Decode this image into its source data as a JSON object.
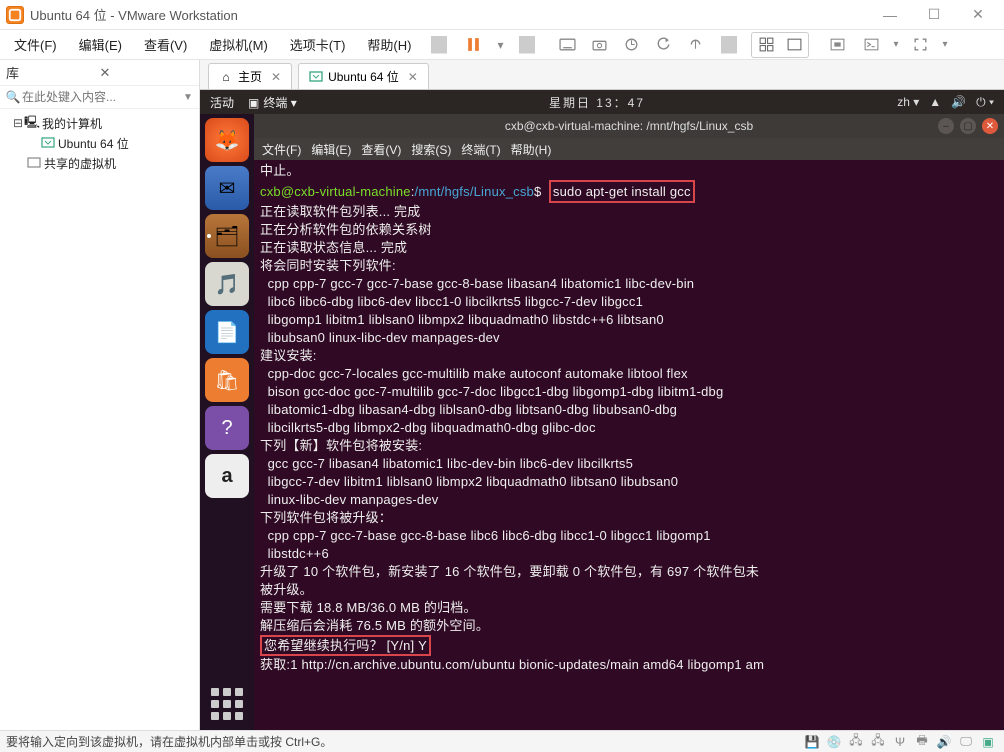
{
  "window": {
    "title": "Ubuntu 64 位 - VMware Workstation"
  },
  "menu": {
    "file": "文件(F)",
    "edit": "编辑(E)",
    "view": "查看(V)",
    "vm": "虚拟机(M)",
    "tabs": "选项卡(T)",
    "help": "帮助(H)"
  },
  "sidebar": {
    "title": "库",
    "search_placeholder": "在此处键入内容...",
    "tree": {
      "root": "我的计算机",
      "child1": "Ubuntu 64 位",
      "child2": "共享的虚拟机"
    }
  },
  "tabs": {
    "home": "主页",
    "vm": "Ubuntu 64 位"
  },
  "gnome": {
    "activities": "活动",
    "terminal_label": "终端 ▾",
    "clock": "星期日 13：47",
    "lang": "zh ▾"
  },
  "terminal": {
    "title": "cxb@cxb-virtual-machine: /mnt/hgfs/Linux_csb",
    "menu": {
      "file": "文件(F)",
      "edit": "编辑(E)",
      "view": "查看(V)",
      "search": "搜索(S)",
      "term": "终端(T)",
      "help": "帮助(H)"
    },
    "prompt_user": "cxb@cxb-virtual-machine",
    "prompt_path": "/mnt/hgfs/Linux_csb",
    "cmd": "sudo apt-get install gcc",
    "lines": [
      "中止。",
      "正在读取软件包列表... 完成",
      "正在分析软件包的依赖关系树",
      "正在读取状态信息... 完成",
      "将会同时安装下列软件:",
      "  cpp cpp-7 gcc-7 gcc-7-base gcc-8-base libasan4 libatomic1 libc-dev-bin",
      "  libc6 libc6-dbg libc6-dev libcc1-0 libcilkrts5 libgcc-7-dev libgcc1",
      "  libgomp1 libitm1 liblsan0 libmpx2 libquadmath0 libstdc++6 libtsan0",
      "  libubsan0 linux-libc-dev manpages-dev",
      "建议安装:",
      "  cpp-doc gcc-7-locales gcc-multilib make autoconf automake libtool flex",
      "  bison gcc-doc gcc-7-multilib gcc-7-doc libgcc1-dbg libgomp1-dbg libitm1-dbg",
      "  libatomic1-dbg libasan4-dbg liblsan0-dbg libtsan0-dbg libubsan0-dbg",
      "  libcilkrts5-dbg libmpx2-dbg libquadmath0-dbg glibc-doc",
      "下列【新】软件包将被安装:",
      "  gcc gcc-7 libasan4 libatomic1 libc-dev-bin libc6-dev libcilkrts5",
      "  libgcc-7-dev libitm1 liblsan0 libmpx2 libquadmath0 libtsan0 libubsan0",
      "  linux-libc-dev manpages-dev",
      "下列软件包将被升级：",
      "  cpp cpp-7 gcc-7-base gcc-8-base libc6 libc6-dbg libcc1-0 libgcc1 libgomp1",
      "  libstdc++6",
      "升级了 10 个软件包，新安装了 16 个软件包，要卸载 0 个软件包，有 697 个软件包未",
      "被升级。",
      "需要下载 18.8 MB/36.0 MB 的归档。",
      "解压缩后会消耗 76.5 MB 的额外空间。"
    ],
    "confirm": "您希望继续执行吗？ [Y/n] Y",
    "after": "获取:1 http://cn.archive.ubuntu.com/ubuntu bionic-updates/main amd64 libgomp1 am"
  },
  "statusbar": {
    "text": "要将输入定向到该虚拟机，请在虚拟机内部单击或按 Ctrl+G。"
  }
}
